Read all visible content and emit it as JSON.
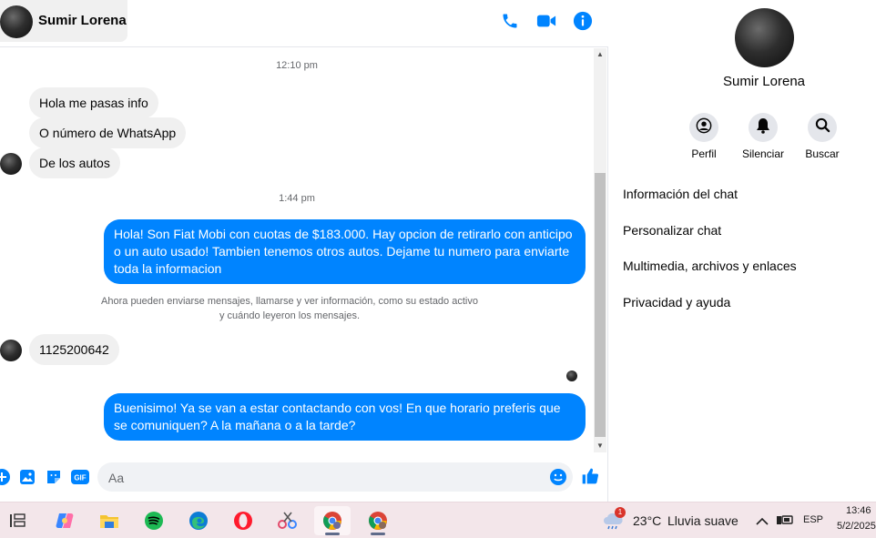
{
  "header": {
    "name": "Sumir Lorena"
  },
  "messages": {
    "ts1": "12:10 pm",
    "in1": "Hola me pasas info",
    "in2": "O número de WhatsApp",
    "in3": "De los autos",
    "ts2": "1:44 pm",
    "out1": "Hola! Son Fiat Mobi con cuotas de $183.000. Hay opcion de retirarlo con anticipo o un auto usado! Tambien tenemos otros autos. Dejame tu numero para enviarte toda la informacion",
    "notice_line1": "Ahora pueden enviarse mensajes, llamarse y ver información, como su estado activo",
    "notice_line2": "y cuándo leyeron los mensajes.",
    "in4": "1125200642",
    "out2": "Buenisimo! Ya se van a estar contactando con vos! En que horario preferis que se comuniquen? A la mañana o a la tarde?"
  },
  "composer": {
    "placeholder": "Aa"
  },
  "info": {
    "name": "Sumir Lorena",
    "actions": [
      {
        "label": "Perfil",
        "icon": "profile-icon"
      },
      {
        "label": "Silenciar",
        "icon": "bell-icon"
      },
      {
        "label": "Buscar",
        "icon": "search-icon"
      }
    ],
    "menu": [
      "Información del chat",
      "Personalizar chat",
      "Multimedia, archivos y enlaces",
      "Privacidad y ayuda"
    ]
  },
  "taskbar": {
    "weather_temp": "23°C",
    "weather_desc": "Lluvia suave",
    "lang": "ESP",
    "time": "13:46",
    "date": "5/2/2025",
    "weather_badge": "1"
  },
  "colors": {
    "accent": "#0084ff",
    "incoming": "#f0f0f0",
    "taskbar": "#f3e6ea"
  }
}
